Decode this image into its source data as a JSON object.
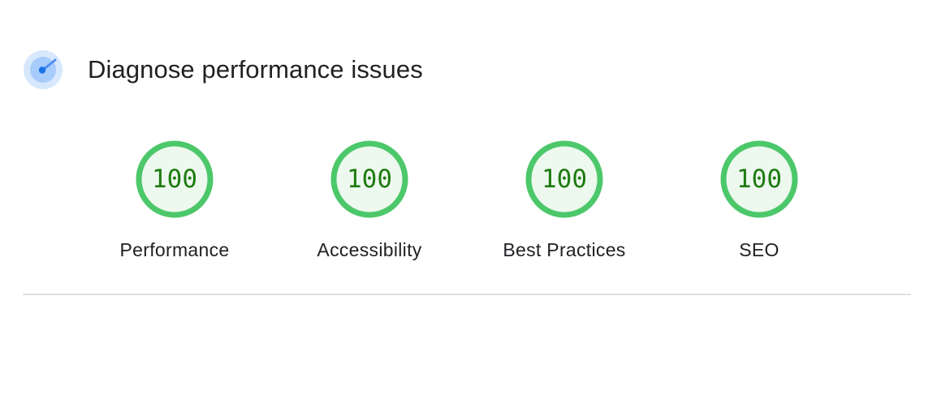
{
  "header": {
    "title": "Diagnose performance issues",
    "icon": "lighthouse-gauge-icon"
  },
  "gauges": [
    {
      "label": "Performance",
      "score": "100",
      "value": 100
    },
    {
      "label": "Accessibility",
      "score": "100",
      "value": 100
    },
    {
      "label": "Best Practices",
      "score": "100",
      "value": 100
    },
    {
      "label": "SEO",
      "score": "100",
      "value": 100
    }
  ],
  "colors": {
    "pass_ring": "#4cc86a",
    "pass_fill": "#edf8ee",
    "pass_text": "#1e7b10",
    "icon_outer": "#d7e8fd",
    "icon_mid": "#a7cbfb",
    "icon_accent": "#1a73e8"
  }
}
